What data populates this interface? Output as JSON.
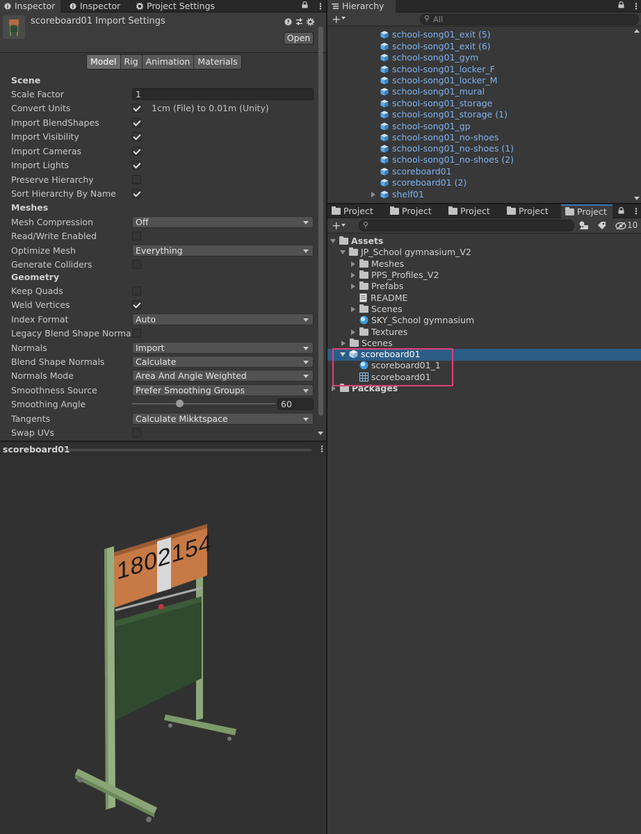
{
  "inspector": {
    "tabs": [
      "Inspector",
      "Inspector",
      "Project Settings"
    ],
    "title": "scoreboard01 Import Settings",
    "open_label": "Open",
    "subtabs": [
      "Model",
      "Rig",
      "Animation",
      "Materials"
    ],
    "sections": {
      "scene": "Scene",
      "meshes": "Meshes",
      "geometry": "Geometry"
    },
    "fields": {
      "scale_factor": {
        "label": "Scale Factor",
        "value": "1"
      },
      "convert_units": {
        "label": "Convert Units",
        "checked": true,
        "note": "1cm (File) to 0.01m (Unity)"
      },
      "import_blendshapes": {
        "label": "Import BlendShapes",
        "checked": true
      },
      "import_visibility": {
        "label": "Import Visibility",
        "checked": true
      },
      "import_cameras": {
        "label": "Import Cameras",
        "checked": true
      },
      "import_lights": {
        "label": "Import Lights",
        "checked": true
      },
      "preserve_hierarchy": {
        "label": "Preserve Hierarchy",
        "checked": false
      },
      "sort_hierarchy": {
        "label": "Sort Hierarchy By Name",
        "checked": true
      },
      "mesh_compression": {
        "label": "Mesh Compression",
        "value": "Off"
      },
      "read_write": {
        "label": "Read/Write Enabled",
        "checked": false
      },
      "optimize_mesh": {
        "label": "Optimize Mesh",
        "value": "Everything"
      },
      "generate_colliders": {
        "label": "Generate Colliders",
        "checked": false
      },
      "keep_quads": {
        "label": "Keep Quads",
        "checked": false
      },
      "weld_vertices": {
        "label": "Weld Vertices",
        "checked": true
      },
      "index_format": {
        "label": "Index Format",
        "value": "Auto"
      },
      "legacy_blend": {
        "label": "Legacy Blend Shape Normals",
        "checked": false
      },
      "normals": {
        "label": "Normals",
        "value": "Import"
      },
      "blend_shape_normals": {
        "label": "Blend Shape Normals",
        "value": "Calculate"
      },
      "normals_mode": {
        "label": "Normals Mode",
        "value": "Area And Angle Weighted"
      },
      "smoothness_source": {
        "label": "Smoothness Source",
        "value": "Prefer Smoothing Groups"
      },
      "smoothing_angle": {
        "label": "Smoothing Angle",
        "value": "60",
        "slider_fraction": 0.33
      },
      "tangents": {
        "label": "Tangents",
        "value": "Calculate Mikktspace"
      },
      "swap_uvs": {
        "label": "Swap UVs",
        "checked": false
      }
    }
  },
  "preview": {
    "title": "scoreboard01",
    "digits": [
      "1",
      "8",
      "0",
      "2",
      "1",
      "5",
      "4"
    ]
  },
  "hierarchy": {
    "tab": "Hierarchy",
    "search_placeholder": "All",
    "items": [
      "school-song01_exit (5)",
      "school-song01_exit (6)",
      "school-song01_gym",
      "school-song01_locker_F",
      "school-song01_locker_M",
      "school-song01_mural",
      "school-song01_storage",
      "school-song01_storage (1)",
      "school-song01_gp",
      "school-song01_no-shoes",
      "school-song01_no-shoes (1)",
      "school-song01_no-shoes (2)",
      "scoreboard01",
      "scoreboard01 (2)",
      "shelf01"
    ]
  },
  "project": {
    "tabs": [
      "Project",
      "Project",
      "Project",
      "Project",
      "Project"
    ],
    "hidden_count": "10",
    "tree": {
      "assets": "Assets",
      "jp_school": "JP_School gymnasium_V2",
      "meshes": "Meshes",
      "pps": "PPS_Profiles_V2",
      "prefabs": "Prefabs",
      "readme": "README",
      "scenes_inner": "Scenes",
      "sky": "SKY_School gymnasium",
      "textures": "Textures",
      "scenes": "Scenes",
      "scoreboard": "scoreboard01",
      "scoreboard_mat": "scoreboard01_1",
      "scoreboard_mesh": "scoreboard01",
      "packages": "Packages"
    }
  },
  "colors": {
    "link_blue": "#7fb2f0",
    "selection": "#2c5d87",
    "highlight_box": "#e0407a"
  }
}
